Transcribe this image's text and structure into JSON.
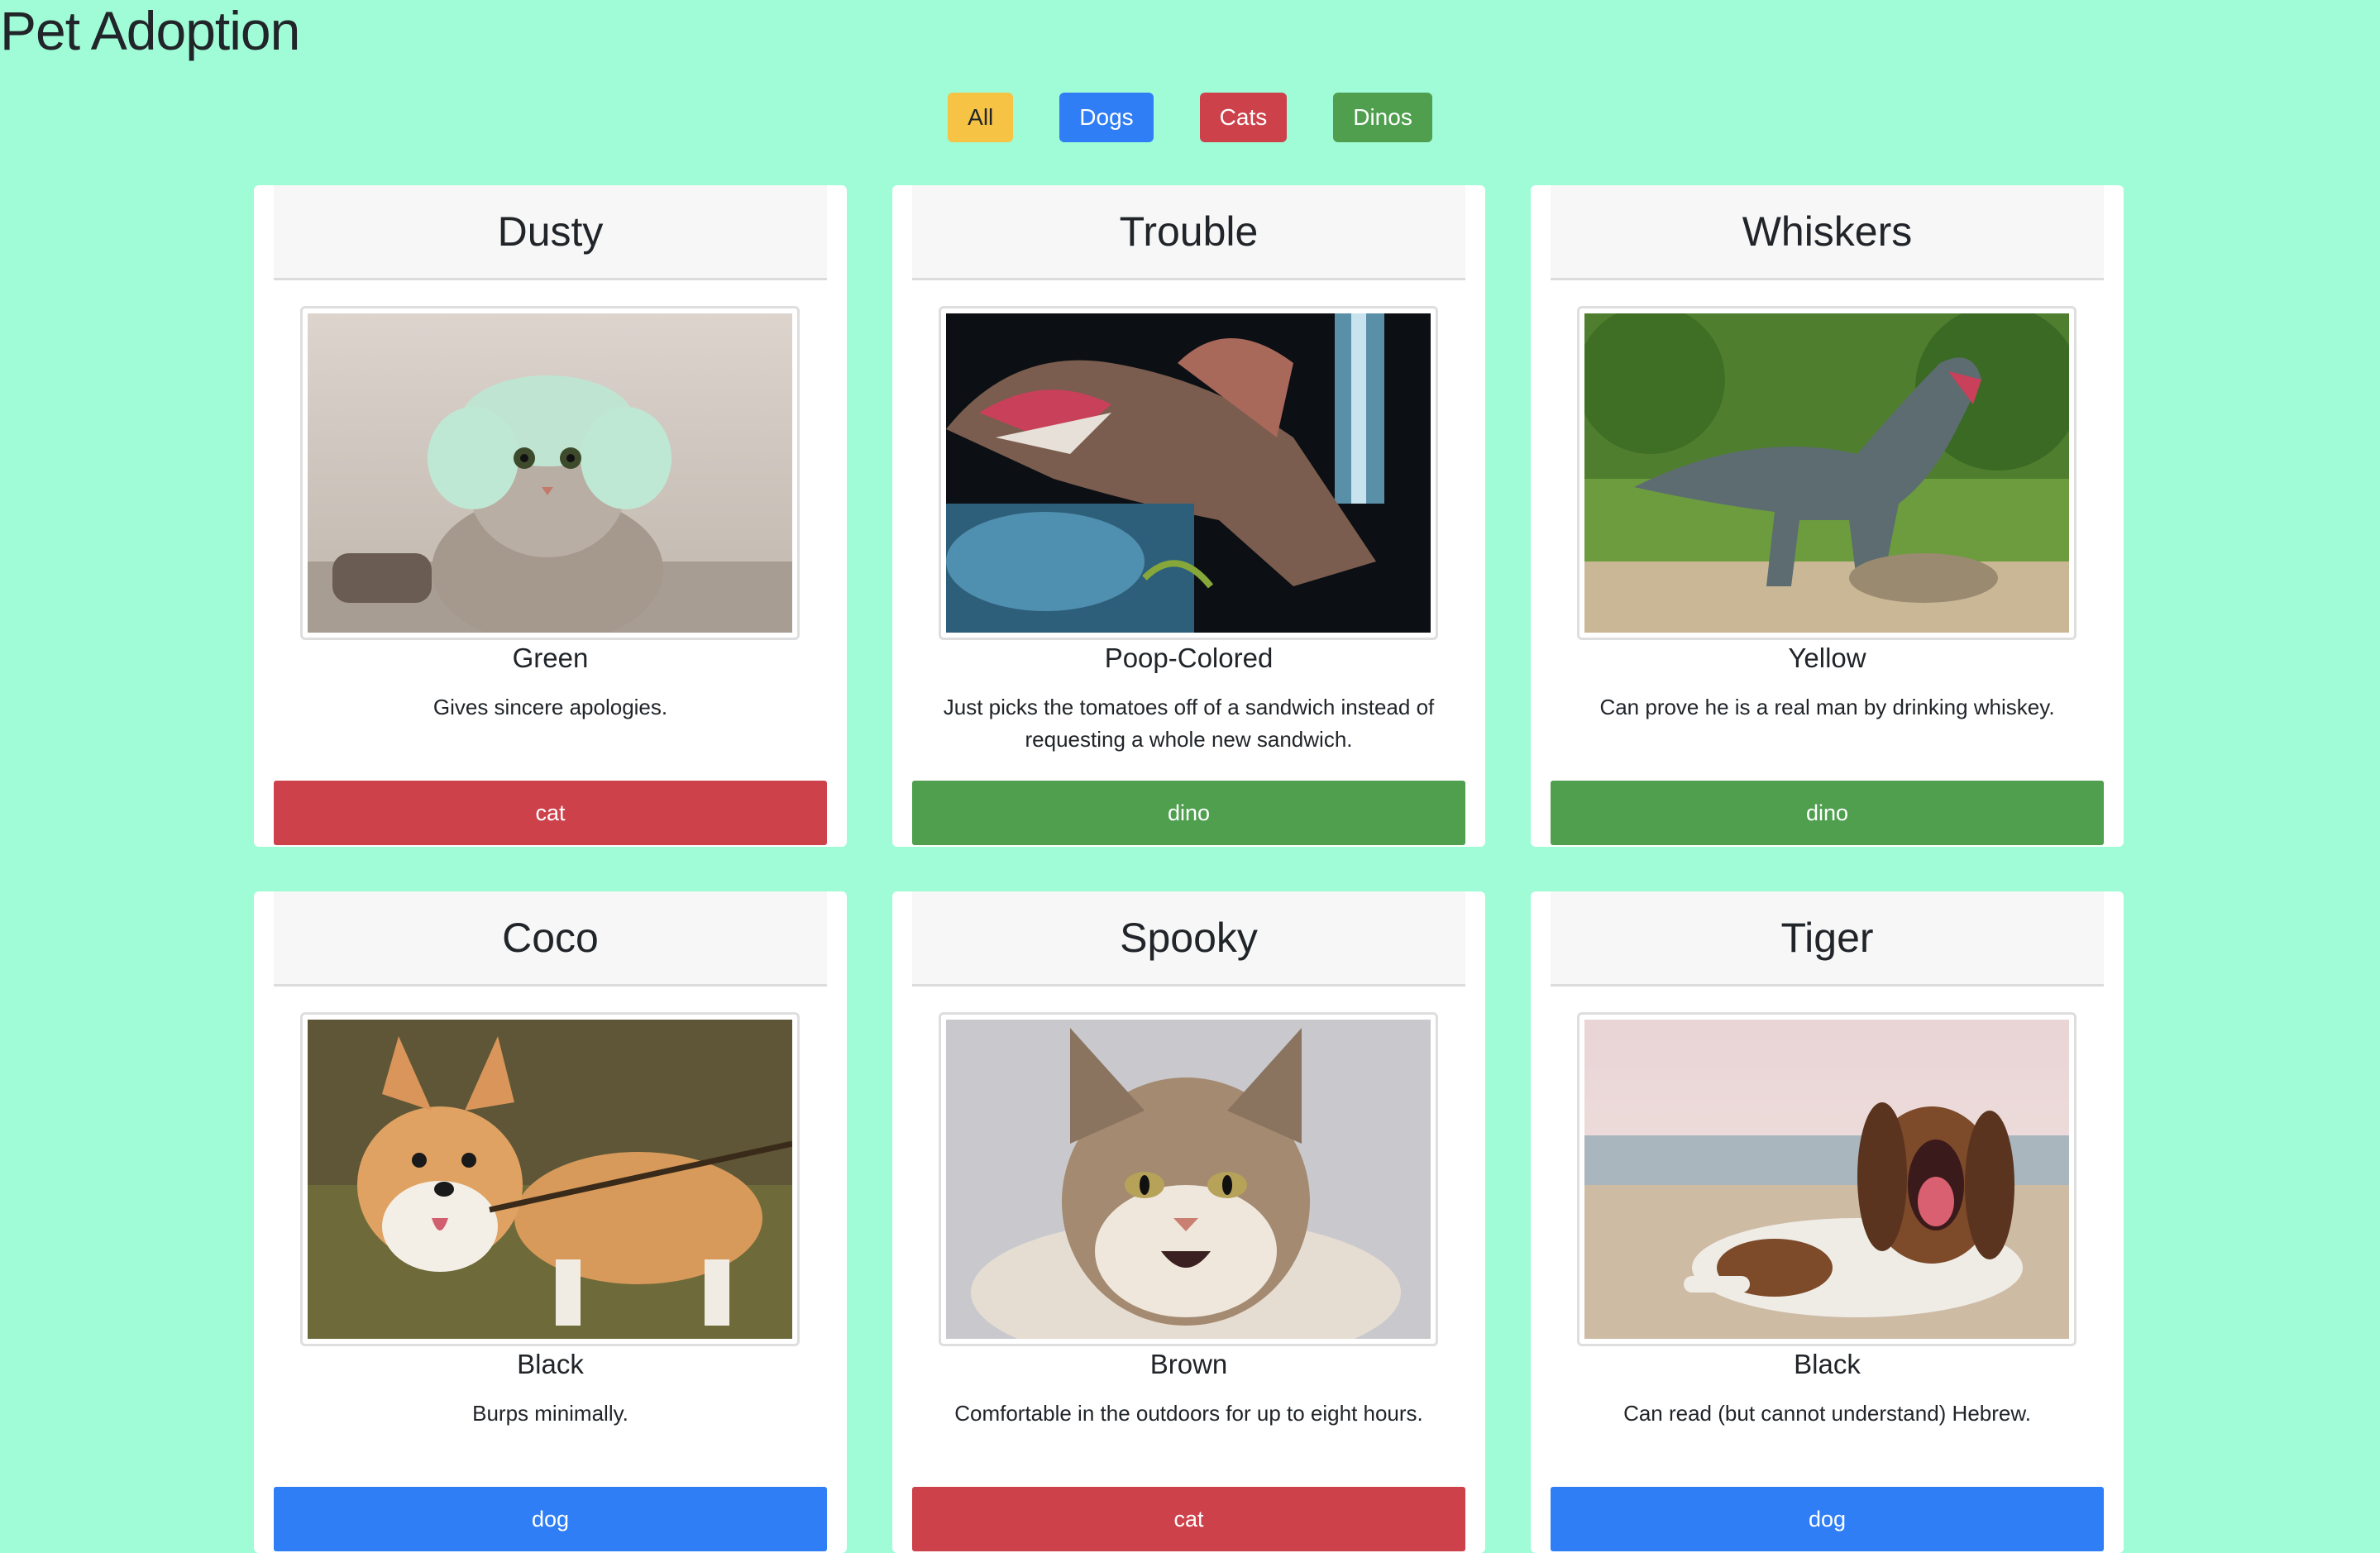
{
  "page_title": "Pet Adoption",
  "filters": [
    {
      "label": "All",
      "variant": "all",
      "color": "#f6c344"
    },
    {
      "label": "Dogs",
      "variant": "dogs",
      "color": "#2f7ef6"
    },
    {
      "label": "Cats",
      "variant": "cats",
      "color": "#cd414b"
    },
    {
      "label": "Dinos",
      "variant": "dinos",
      "color": "#4f9f4f"
    }
  ],
  "pets": [
    {
      "name": "Dusty",
      "color": "Green",
      "description": "Gives sincere apologies.",
      "type": "cat",
      "photo": "cat-with-towel-hat-photo"
    },
    {
      "name": "Trouble",
      "color": "Poop-Colored",
      "description": "Just picks the tomatoes off of a sandwich instead of requesting a whole new sandwich.",
      "type": "dino",
      "photo": "spinosaurus-photo"
    },
    {
      "name": "Whiskers",
      "color": "Yellow",
      "description": "Can prove he is a real man by drinking whiskey.",
      "type": "dino",
      "photo": "t-rex-in-forest-photo"
    },
    {
      "name": "Coco",
      "color": "Black",
      "description": "Burps minimally.",
      "type": "dog",
      "photo": "corgi-with-stick-photo"
    },
    {
      "name": "Spooky",
      "color": "Brown",
      "description": "Comfortable in the outdoors for up to eight hours.",
      "type": "cat",
      "photo": "maine-coon-cat-photo"
    },
    {
      "name": "Tiger",
      "color": "Black",
      "description": "Can read (but cannot understand) Hebrew.",
      "type": "dog",
      "photo": "basset-hound-on-beach-photo"
    }
  ],
  "type_colors": {
    "cat": "#cd414b",
    "dino": "#4f9f4f",
    "dog": "#2f7ef6"
  },
  "background_color": "#9ffcd6"
}
